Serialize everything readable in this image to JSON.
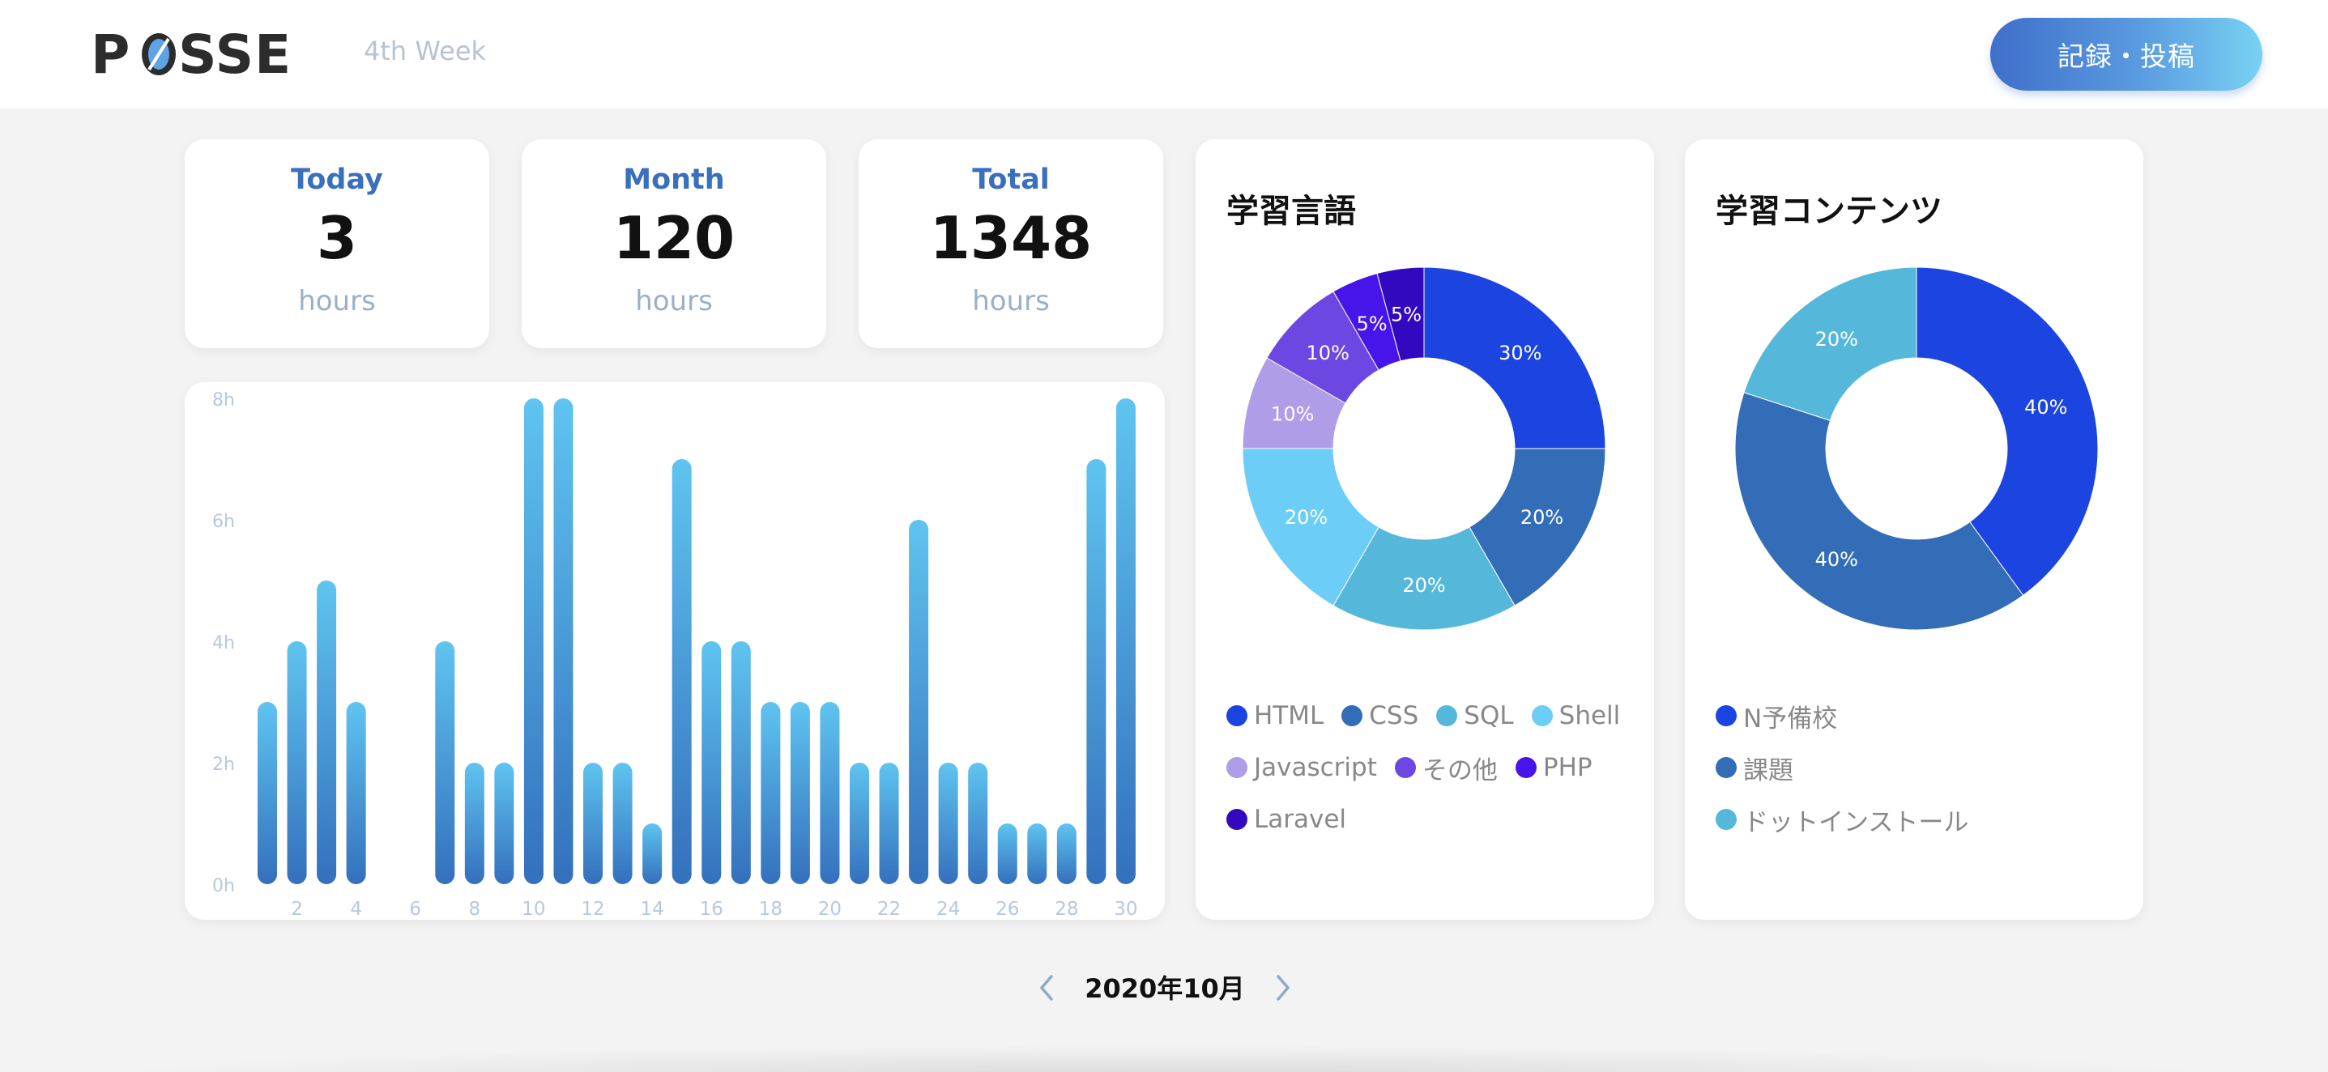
{
  "header": {
    "logo_text": "POSSE",
    "week": "4th Week",
    "post_button": "記録・投稿"
  },
  "stats": [
    {
      "label": "Today",
      "value": "3",
      "unit": "hours"
    },
    {
      "label": "Month",
      "value": "120",
      "unit": "hours"
    },
    {
      "label": "Total",
      "value": "1348",
      "unit": "hours"
    }
  ],
  "chart_data": [
    {
      "type": "bar",
      "y_ticks": [
        "0h",
        "2h",
        "4h",
        "6h",
        "8h"
      ],
      "ylim": [
        0,
        8
      ],
      "x_ticks": [
        "2",
        "4",
        "6",
        "8",
        "10",
        "12",
        "14",
        "16",
        "18",
        "20",
        "22",
        "24",
        "26",
        "28",
        "30"
      ],
      "categories": [
        1,
        2,
        3,
        4,
        5,
        6,
        7,
        8,
        9,
        10,
        11,
        12,
        13,
        14,
        15,
        16,
        17,
        18,
        19,
        20,
        21,
        22,
        23,
        24,
        25,
        26,
        27,
        28,
        29,
        30
      ],
      "values": [
        3,
        4,
        5,
        3,
        0,
        0,
        4,
        2,
        2,
        8,
        8,
        2,
        2,
        1,
        7,
        4,
        4,
        3,
        3,
        3,
        2,
        2,
        6,
        2,
        2,
        1,
        1,
        1,
        7,
        8
      ],
      "colors": {
        "bar_top": "#5fc4f0",
        "bar_bottom": "#3470bd",
        "tick": "#b7c8de"
      }
    },
    {
      "type": "pie",
      "title": "学習言語",
      "labels": [
        "HTML",
        "CSS",
        "SQL",
        "Shell",
        "Javascript",
        "その他",
        "PHP",
        "Laravel"
      ],
      "values": [
        30,
        20,
        20,
        20,
        10,
        10,
        5,
        5
      ],
      "value_labels": [
        "30%",
        "20%",
        "20%",
        "20%",
        "10%",
        "10%",
        "5%",
        "5%"
      ],
      "colors": [
        "#1c44e0",
        "#336db7",
        "#55b8da",
        "#6ccdf7",
        "#af9de8",
        "#6d47e2",
        "#4714ea",
        "#3309bf"
      ]
    },
    {
      "type": "pie",
      "title": "学習コンテンツ",
      "labels": [
        "N予備校",
        "課題",
        "ドットインストール"
      ],
      "values": [
        40,
        40,
        20
      ],
      "value_labels": [
        "40%",
        "40%",
        "20%"
      ],
      "colors": [
        "#1c44e0",
        "#336db7",
        "#55b8da"
      ]
    }
  ],
  "month_nav": {
    "label": "2020年10月",
    "prev_icon": "chevron-left-icon",
    "next_icon": "chevron-right-icon"
  }
}
